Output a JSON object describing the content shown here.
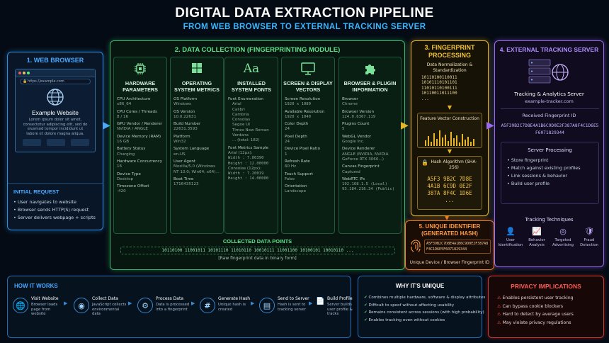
{
  "header": {
    "title": "DIGITAL DATA EXTRACTION PIPELINE",
    "subtitle": "FROM WEB BROWSER TO EXTERNAL TRACKING SERVER"
  },
  "browser": {
    "title": "1. WEB BROWSER",
    "url": "https://example.com",
    "site_title": "Example Website",
    "lorem": "Lorem ipsum dolor sit amet, consectetur adipiscing elit, sed do eiusmod tempor incididunt ut labore et dolore magna aliqua.",
    "request_title": "INITIAL REQUEST",
    "request_items": [
      "User navigates to website",
      "Browser sends HTTP(S) request",
      "Server delivers webpage + scripts"
    ]
  },
  "collection": {
    "title": "2. DATA COLLECTION (FINGERPRINTING MODULE)",
    "columns": [
      {
        "heading": "HARDWARE PARAMETERS",
        "icon": "chip-icon",
        "lines": [
          [
            "CPU Architecture",
            "x86_64"
          ],
          [
            "CPU Cores / Threads",
            "8 / 16"
          ],
          [
            "GPU Vendor / Renderer",
            "NVIDIA / ANGLE"
          ],
          [
            "Device Memory (RAM)",
            "16 GB"
          ],
          [
            "Battery Status",
            "Charging"
          ],
          [
            "Hardware Concurrency",
            "16"
          ],
          [
            "Device Type",
            "Desktop"
          ],
          [
            "Timezone Offset",
            "-420"
          ]
        ]
      },
      {
        "heading": "OPERATING SYSTEM METRICS",
        "icon": "windows-icon",
        "lines": [
          [
            "OS Platform",
            "Windows"
          ],
          [
            "OS Version",
            "10.0.22631"
          ],
          [
            "Build Number",
            "22631.3593"
          ],
          [
            "Platform",
            "Win32"
          ],
          [
            "System Language",
            "en-US"
          ],
          [
            "User Agent",
            "Mozilla/5.0 (Windows NT 10.0; Win64; x64)..."
          ],
          [
            "Boot Time",
            "1716435123"
          ]
        ]
      },
      {
        "heading": "INSTALLED SYSTEM FONTS",
        "icon": "font-icon",
        "enum_label": "Font Enumeration",
        "fonts": [
          "Arial",
          "Calibri",
          "Cambria",
          "Consolas",
          "Segoe UI",
          "Times New Roman",
          "Verdana",
          "... (total: 182)"
        ],
        "metrics_label": "Font Metrics Sample",
        "metrics": [
          "Arial (12px):",
          "Width : 7.00390",
          "Height : 12.00000",
          "Consolas (12px):",
          "Width : 7.20019",
          "Height : 14.00000"
        ]
      },
      {
        "heading": "SCREEN & DISPLAY VECTORS",
        "icon": "monitor-icon",
        "lines": [
          [
            "Screen Resolution",
            "1920 x 1080"
          ],
          [
            "Available Resolution",
            "1920 x 1040"
          ],
          [
            "Color Depth",
            "24"
          ],
          [
            "Pixel Depth",
            "24"
          ],
          [
            "Device Pixel Ratio",
            "1"
          ],
          [
            "Refresh Rate",
            "60 Hz"
          ],
          [
            "Touch Support",
            "False"
          ],
          [
            "Orientation",
            "Landscape"
          ]
        ]
      },
      {
        "heading": "BROWSER & PLUGIN INFORMATION",
        "icon": "puzzle-icon",
        "lines": [
          [
            "Browser",
            "Chrome"
          ],
          [
            "Browser Version",
            "124.0.6367.119"
          ],
          [
            "Plugins Count",
            "5"
          ],
          [
            "WebGL Vendor",
            "Google Inc."
          ],
          [
            "Device Renderer",
            "ANGLE (NVIDIA, NVIDIA GeForce RTX 3060...)"
          ],
          [
            "Canvas Fingerprint",
            "Captured"
          ],
          [
            "WebRTC IPs",
            "192.168.1.5 (Local) 93.184.216.34 (Public)"
          ]
        ]
      }
    ],
    "collected_title": "COLLECTED DATA POINTS",
    "binary": "10110100 11001011 10101110 11010110 10010111 11001100 10100101 10010110 ...",
    "binary_caption": "[Raw fingerprint data in binary form]"
  },
  "fingerprint": {
    "title": "3. FINGERPRINT PROCESSING",
    "normalize": "Data Normalization & Standardization",
    "bits": [
      "10110100110011",
      "10101110101101",
      "11010110100111",
      "10110011011100",
      "..."
    ],
    "vector": "Feature Vector Construction",
    "hash_title": "Hash Algorithm (SHA-256)",
    "hash": [
      "A5F3 9B2C 7D8E",
      "4A1B 6C9D 0E2F",
      "387A 8F4C 1D6E",
      "..."
    ]
  },
  "unique": {
    "title": "5. UNIQUE IDENTIFIER (GENERATED HASH)",
    "hash": "A5F39B2C7D8E4A1B6C9D0E2F387A8F4C1D6E5F6071829344",
    "caption": "Unique Device / Browser Fingerprint ID"
  },
  "tracking": {
    "title": "4. EXTERNAL TRACKING SERVER",
    "server_name": "Tracking & Analytics Server",
    "domain": "example-tracker.com",
    "received_label": "Received Fingerprint ID",
    "received_hash": "A5F39B2C7D8E4A1B6C9D0E2F387A8F4C1D6E5F6071829344",
    "processing_title": "Server Processing",
    "processing_items": [
      "Store fingerprint",
      "Match against existing profiles",
      "Link sessions & behavior",
      "Build user profile"
    ],
    "techniques_title": "Tracking Techniques",
    "techniques": [
      "User Identification",
      "Behavior Analysis",
      "Targeted Advertising",
      "Fraud Detection"
    ]
  },
  "how": {
    "title": "HOW IT WORKS",
    "steps": [
      {
        "name": "Visit Website",
        "desc": "Browser loads page from website"
      },
      {
        "name": "Collect Data",
        "desc": "JavaScript collects environmental data"
      },
      {
        "name": "Process Data",
        "desc": "Data is processed into a fingerprint"
      },
      {
        "name": "Generate Hash",
        "desc": "Unique hash is created"
      },
      {
        "name": "Send to Server",
        "desc": "Hash is sent to tracking server"
      },
      {
        "name": "Build Profile",
        "desc": "Server builds user profile & tracks"
      }
    ]
  },
  "why": {
    "title": "WHY IT'S UNIQUE",
    "items": [
      "Combines multiple hardware, software & display attributes",
      "Difficult to spoof without affecting usability",
      "Remains consistent across sessions (with high probability)",
      "Enables tracking even without cookies"
    ]
  },
  "privacy": {
    "title": "PRIVACY IMPLICATIONS",
    "items": [
      "Enables persistent user tracking",
      "Can bypass cookie blockers",
      "Hard to detect by average users",
      "May violate privacy regulations"
    ]
  },
  "colors": {
    "browser": "#2d8fe0",
    "collection": "#3db86a",
    "fingerprint": "#e8b526",
    "tracking": "#9a6af0",
    "unique": "#f07c24",
    "privacy": "#d03a32"
  }
}
